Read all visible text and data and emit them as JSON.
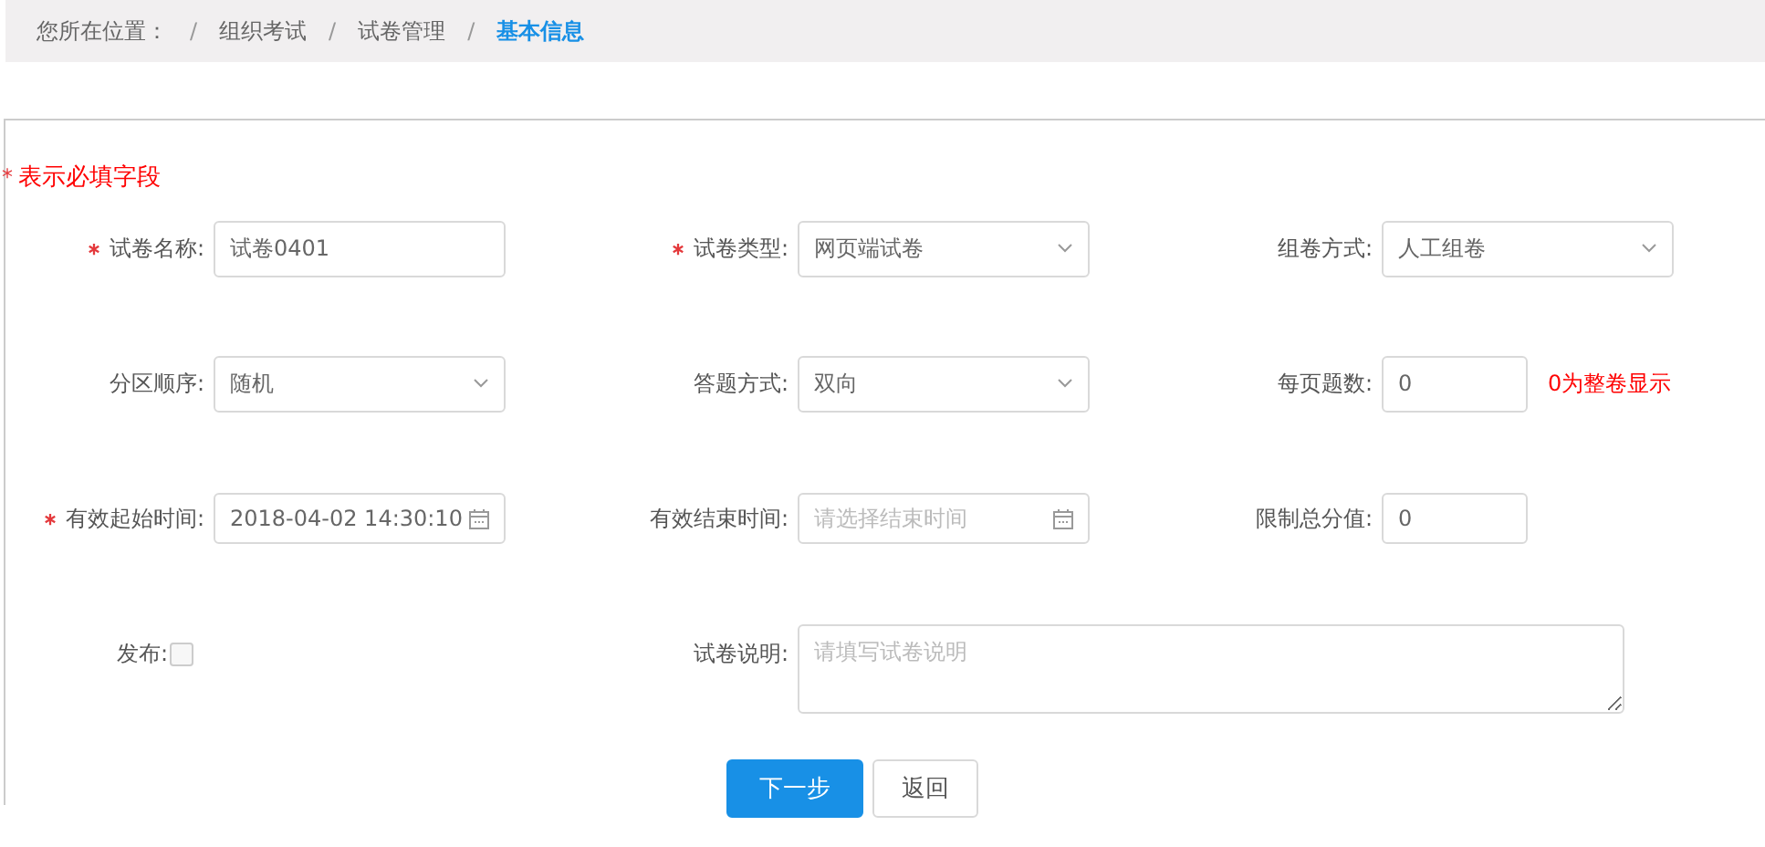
{
  "breadcrumb": {
    "prefix": "您所在位置：",
    "items": [
      {
        "label": "组织考试",
        "separator": "/",
        "selected": false
      },
      {
        "label": "试卷管理",
        "separator": "/",
        "selected": false
      },
      {
        "label": "基本信息",
        "separator": "/",
        "selected": true
      }
    ]
  },
  "required_note": {
    "mark": "*",
    "text": "表示必填字段"
  },
  "fields": [
    {
      "kind": "input",
      "required": true,
      "label": "试卷名称:",
      "value": "试卷0401"
    },
    {
      "kind": "select",
      "required": true,
      "label": "试卷类型:",
      "value": "网页端试卷"
    },
    {
      "kind": "select",
      "required": false,
      "label": "组卷方式:",
      "value": "人工组卷"
    },
    {
      "kind": "select",
      "required": false,
      "label": "分区顺序:",
      "value": "随机"
    },
    {
      "kind": "select",
      "required": false,
      "label": "答题方式:",
      "value": "双向"
    },
    {
      "kind": "number",
      "required": false,
      "label": "每页题数:",
      "value": "0",
      "hint": "0为整卷显示"
    },
    {
      "kind": "date",
      "required": true,
      "label": "有效起始时间:",
      "value": "2018-04-02 14:30:10"
    },
    {
      "kind": "date",
      "required": false,
      "label": "有效结束时间:",
      "placeholder": "请选择结束时间"
    },
    {
      "kind": "number",
      "required": false,
      "label": "限制总分值:",
      "value": "0"
    },
    {
      "kind": "checkbox",
      "required": false,
      "label": "发布:",
      "checked": false
    },
    {
      "kind": "textarea",
      "required": false,
      "label": "试卷说明:",
      "placeholder": "请填写试卷说明"
    }
  ],
  "buttons": [
    {
      "kind": "primary",
      "label": "下一步"
    },
    {
      "kind": "default",
      "label": "返回"
    }
  ]
}
